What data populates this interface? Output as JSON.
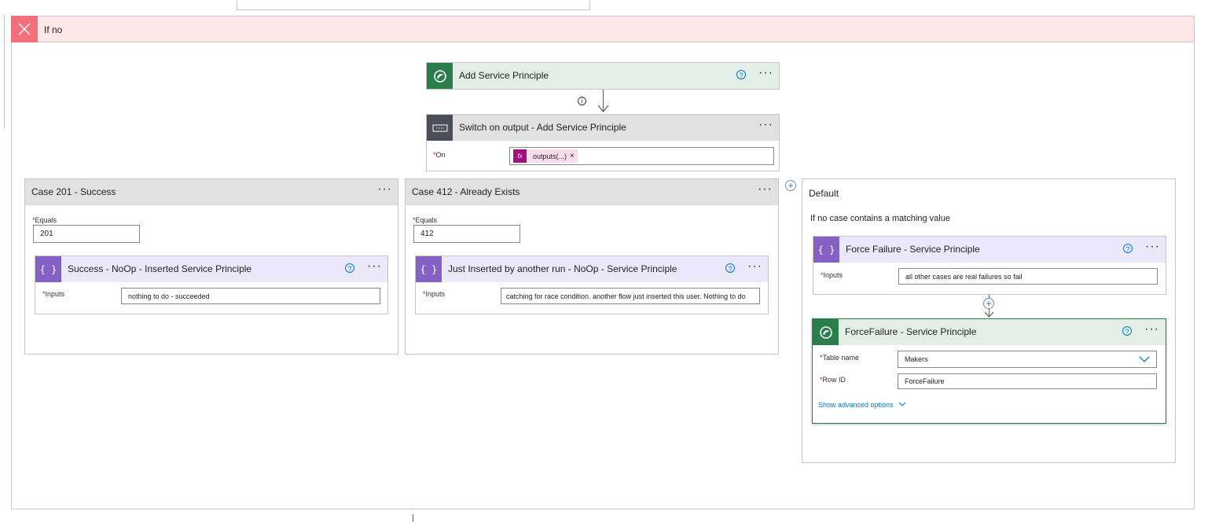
{
  "scope": {
    "title": "If no"
  },
  "add_sp": {
    "title": "Add Service Principle",
    "icon": "dataverse-icon"
  },
  "switch": {
    "title": "Switch on output - Add Service Principle",
    "on_label": "On",
    "token": "outputs(...)",
    "token_close": "×",
    "fx": "fx"
  },
  "cases": [
    {
      "title": "Case 201 - Success",
      "equals_label": "Equals",
      "equals_value": "201",
      "action_title": "Success - NoOp - Inserted Service Principle",
      "inputs_label": "Inputs",
      "inputs_value": "nothing to do - succeeded"
    },
    {
      "title": "Case 412 - Already Exists",
      "equals_label": "Equals",
      "equals_value": "412",
      "action_title": "Just Inserted by another run - NoOp - Service Principle",
      "inputs_label": "Inputs",
      "inputs_value": "catching for race condition. another flow just inserted this user. Nothing to do"
    }
  ],
  "default": {
    "title": "Default",
    "subtitle": "If no case contains a matching value",
    "force_compose": {
      "title": "Force Failure - Service Principle",
      "inputs_label": "Inputs",
      "inputs_value": "all other cases are real failures so fail"
    },
    "force_dv": {
      "title": "ForceFailure - Service Principle",
      "table_label": "Table name",
      "table_value": "Makers",
      "row_label": "Row ID",
      "row_value": "ForceFailure",
      "advanced": "Show advanced options"
    }
  },
  "common": {
    "dots": "···",
    "help": "?",
    "star": "*",
    "plus": "+",
    "info": "i"
  },
  "colors": {
    "dataverse_green": "#2a7e4b",
    "compose_purple": "#8661c5",
    "switch_gray": "#484f58",
    "error_red": "#f1707b"
  }
}
